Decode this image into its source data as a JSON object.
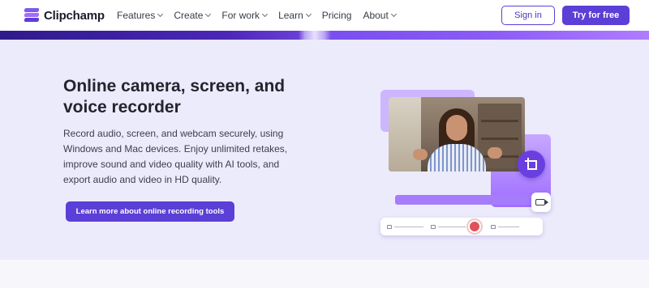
{
  "brand": {
    "name": "Clipchamp"
  },
  "nav": {
    "items": [
      {
        "label": "Features",
        "has_dropdown": true
      },
      {
        "label": "Create",
        "has_dropdown": true
      },
      {
        "label": "For work",
        "has_dropdown": true
      },
      {
        "label": "Learn",
        "has_dropdown": true
      },
      {
        "label": "Pricing",
        "has_dropdown": false
      },
      {
        "label": "About",
        "has_dropdown": true
      }
    ],
    "sign_in": "Sign in",
    "try_free": "Try for free"
  },
  "hero": {
    "title": "Online camera, screen, and voice recorder",
    "description": "Record audio, screen, and webcam securely, using Windows and Mac devices. Enjoy unlimited retakes, improve sound and video quality with AI tools, and export audio and video in HD quality.",
    "cta": "Learn more about online recording tools"
  },
  "colors": {
    "accent": "#5b3fd6",
    "hero_bg": "#ecebfc",
    "record": "#e0525a"
  },
  "icons": {
    "logo": "clipchamp-logo-icon",
    "crop": "crop-icon",
    "camera": "video-camera-icon",
    "record": "record-icon"
  }
}
